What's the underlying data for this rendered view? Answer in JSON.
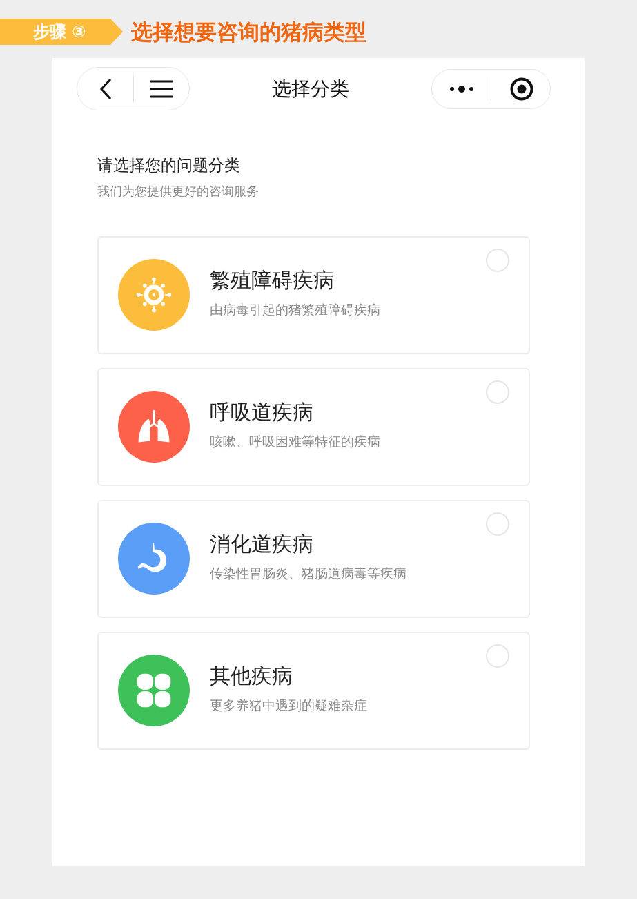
{
  "step_banner": {
    "step": "步骤 ③",
    "title": "选择想要咨询的猪病类型"
  },
  "nav_bar": {
    "title": "选择分类"
  },
  "heading": {
    "title": "请选择您的问题分类",
    "subtitle": "我们为您提供更好的咨询服务"
  },
  "categories": [
    {
      "kind": "virus",
      "color": "#fbbd3b",
      "title": "繁殖障碍疾病",
      "description": "由病毒引起的猪繁殖障碍疾病",
      "selected": false
    },
    {
      "kind": "lungs",
      "color": "#fd614a",
      "title": "呼吸道疾病",
      "description": "咳嗽、呼吸困难等特征的疾病",
      "selected": false
    },
    {
      "kind": "stomach",
      "color": "#5b9ef8",
      "title": "消化道疾病",
      "description": "传染性胃肠炎、猪肠道病毒等疾病",
      "selected": false
    },
    {
      "kind": "clover",
      "color": "#3fc159",
      "title": "其他疾病",
      "description": "更多养猪中遇到的疑难杂症",
      "selected": false
    }
  ]
}
